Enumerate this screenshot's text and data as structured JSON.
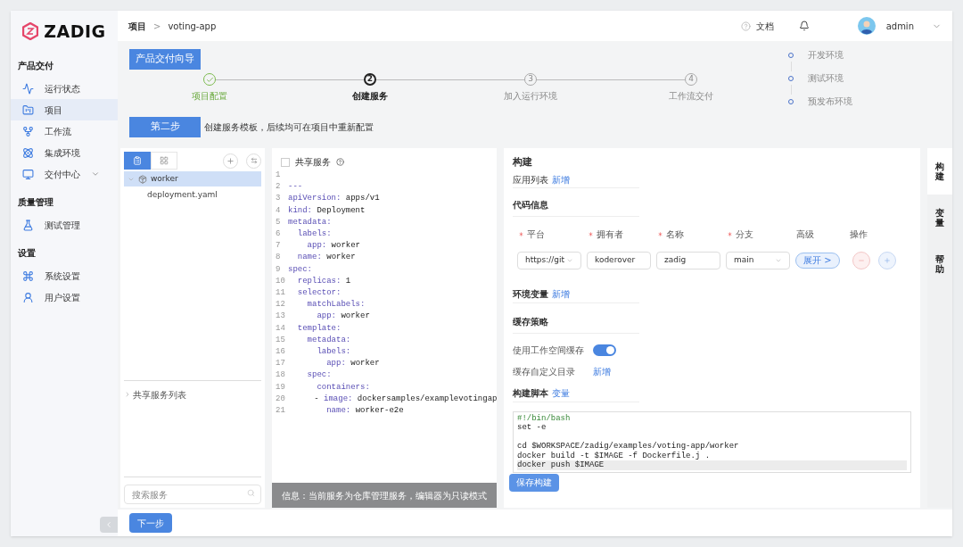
{
  "brand": {
    "name": "ZADIG"
  },
  "sidebar": {
    "sections": [
      {
        "title": "产品交付",
        "items": [
          {
            "label": "运行状态",
            "selected": false
          },
          {
            "label": "项目",
            "selected": true
          },
          {
            "label": "工作流",
            "selected": false
          },
          {
            "label": "集成环境",
            "selected": false
          },
          {
            "label": "交付中心",
            "selected": false,
            "expandable": true
          }
        ]
      },
      {
        "title": "质量管理",
        "items": [
          {
            "label": "测试管理",
            "selected": false
          }
        ]
      },
      {
        "title": "设置",
        "items": [
          {
            "label": "系统设置",
            "selected": false
          },
          {
            "label": "用户设置",
            "selected": false
          }
        ]
      }
    ]
  },
  "header": {
    "breadcrumb": [
      "项目",
      "voting-app"
    ],
    "separator": ">",
    "docs": "文档",
    "user": "admin"
  },
  "wizard": {
    "title": "产品交付向导",
    "steps": [
      {
        "label": "项目配置",
        "completed": true,
        "selected": false
      },
      {
        "number": "2",
        "label": "创建服务",
        "completed": false,
        "selected": true
      },
      {
        "number": "3",
        "label": "加入运行环境",
        "completed": false,
        "selected": false
      },
      {
        "number": "4",
        "label": "工作流交付",
        "completed": false,
        "selected": false
      }
    ],
    "environments": [
      "开发环境",
      "测试环境",
      "预发布环境"
    ]
  },
  "step_banner": {
    "label": "第二步",
    "hint": "创建服务模板，后续均可在项目中重新配置"
  },
  "service_tree": {
    "view_tabs": [
      {
        "selected": true
      },
      {
        "selected": false
      }
    ],
    "items": [
      {
        "label": "worker",
        "expanded": true,
        "selected": true,
        "children": [
          {
            "label": "deployment.yaml",
            "selected": false
          }
        ]
      }
    ],
    "shared_list": {
      "label": "共享服务列表",
      "expanded": false
    },
    "search": {
      "placeholder": "搜索服务"
    }
  },
  "editor": {
    "shared": {
      "label": "共享服务",
      "checked": false
    },
    "lines": [
      {
        "number": "1"
      },
      {
        "number": "2",
        "text": "---"
      },
      {
        "number": "3",
        "text": "apiVersion: apps/v1"
      },
      {
        "number": "4",
        "text": "kind: Deployment"
      },
      {
        "number": "5",
        "text": "metadata:"
      },
      {
        "number": "6",
        "text": "  labels:"
      },
      {
        "number": "7",
        "text": "    app: worker"
      },
      {
        "number": "8",
        "text": "  name: worker"
      },
      {
        "number": "9",
        "text": "spec:"
      },
      {
        "number": "10",
        "text": "  replicas: 1"
      },
      {
        "number": "11",
        "text": "  selector:"
      },
      {
        "number": "12",
        "text": "    matchLabels:"
      },
      {
        "number": "13",
        "text": "      app: worker"
      },
      {
        "number": "14",
        "text": "  template:"
      },
      {
        "number": "15",
        "text": "    metadata:"
      },
      {
        "number": "16",
        "text": "      labels:"
      },
      {
        "number": "17",
        "text": "        app: worker"
      },
      {
        "number": "18",
        "text": "    spec:"
      },
      {
        "number": "19",
        "text": "      containers:"
      },
      {
        "number": "20",
        "text": "      - image: dockersamples/examplevotingap"
      },
      {
        "number": "21",
        "text": "        name: worker-e2e"
      }
    ],
    "notice": "信息：当前服务为仓库管理服务，编辑器为只读模式"
  },
  "build": {
    "title": "构建",
    "app_list": {
      "label": "应用列表",
      "link": "新增"
    },
    "code_info": "代码信息",
    "columns": [
      {
        "label": "平台",
        "required": true
      },
      {
        "label": "拥有者",
        "required": true
      },
      {
        "label": "名称",
        "required": true
      },
      {
        "label": "分支",
        "required": true
      },
      {
        "label": "高级",
        "required": false
      },
      {
        "label": "操作",
        "required": false
      }
    ],
    "repo": {
      "fields": [
        {
          "kind": "select",
          "value": "https://git"
        },
        {
          "kind": "input",
          "value": "koderover"
        },
        {
          "kind": "input",
          "value": "zadig"
        },
        {
          "kind": "select",
          "value": "main"
        }
      ],
      "expand": "展开 >"
    },
    "env_vars": {
      "label": "环境变量",
      "link": "新增"
    },
    "cache": {
      "title": "缓存策略",
      "workspace": {
        "label": "使用工作空间缓存",
        "on": true
      },
      "custom_dir": {
        "label": "缓存自定义目录",
        "link": "新增"
      }
    },
    "script": {
      "label": "构建脚本",
      "link": "变量",
      "lines": [
        {
          "text": "#!/bin/bash",
          "current": false
        },
        {
          "text": "set -e",
          "current": false
        },
        {
          "current": false
        },
        {
          "text": "cd $WORKSPACE/zadig/examples/voting-app/worker",
          "current": false
        },
        {
          "text": "docker build -t $IMAGE -f Dockerfile.j .",
          "current": false
        },
        {
          "text": "docker push $IMAGE",
          "current": true
        }
      ]
    },
    "save": "保存构建"
  },
  "side_tabs": [
    {
      "label": "构建",
      "selected": true
    },
    {
      "label": "变量",
      "selected": false
    },
    {
      "label": "帮助",
      "selected": false
    }
  ],
  "footer": {
    "next": "下一步"
  }
}
